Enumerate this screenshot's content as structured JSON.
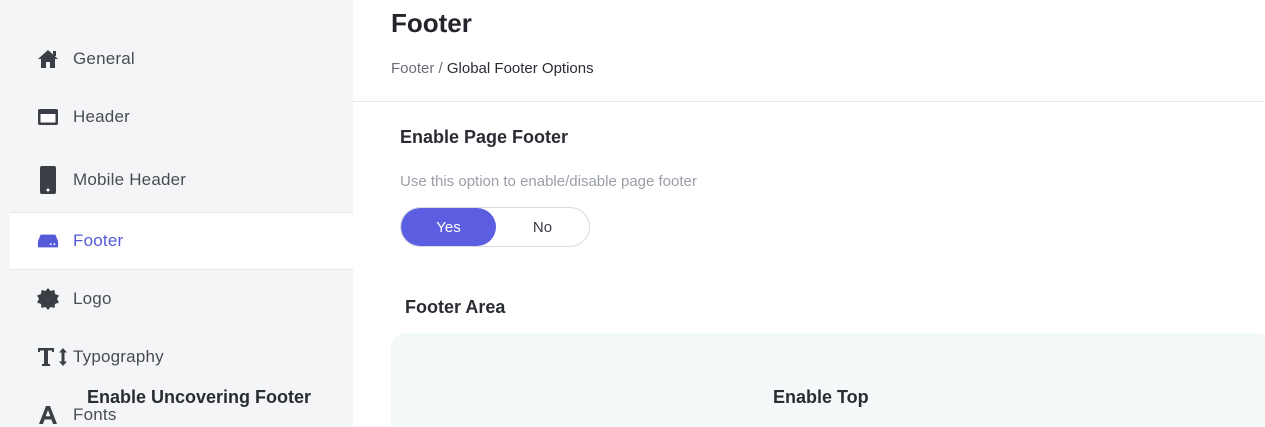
{
  "sidebar": {
    "items": [
      {
        "label": "General",
        "icon": "home-icon"
      },
      {
        "label": "Header",
        "icon": "header-icon"
      },
      {
        "label": "Mobile Header",
        "icon": "mobile-icon"
      },
      {
        "label": "Footer",
        "icon": "footer-icon",
        "active": true
      },
      {
        "label": "Logo",
        "icon": "badge-icon"
      },
      {
        "label": "Typography",
        "icon": "typography-icon"
      },
      {
        "label": "Fonts",
        "icon": "font-icon"
      }
    ]
  },
  "main": {
    "title": "Footer",
    "breadcrumb": {
      "parent": "Footer",
      "separator": " / ",
      "current": "Global Footer Options"
    },
    "enable_footer": {
      "title": "Enable Page Footer",
      "description": "Use this option to enable/disable page footer",
      "toggle": {
        "yes": "Yes",
        "no": "No",
        "selected": "Yes"
      }
    },
    "footer_area": {
      "title": "Footer Area",
      "fields": [
        "Enable Uncovering Footer",
        "Enable Top"
      ]
    }
  },
  "colors": {
    "accent": "#5b5ee0",
    "active_text": "#555bd8",
    "sidebar_bg": "#f4f5f7",
    "icon": "#3c3e45",
    "panel_bg": "#f3f8f8"
  }
}
